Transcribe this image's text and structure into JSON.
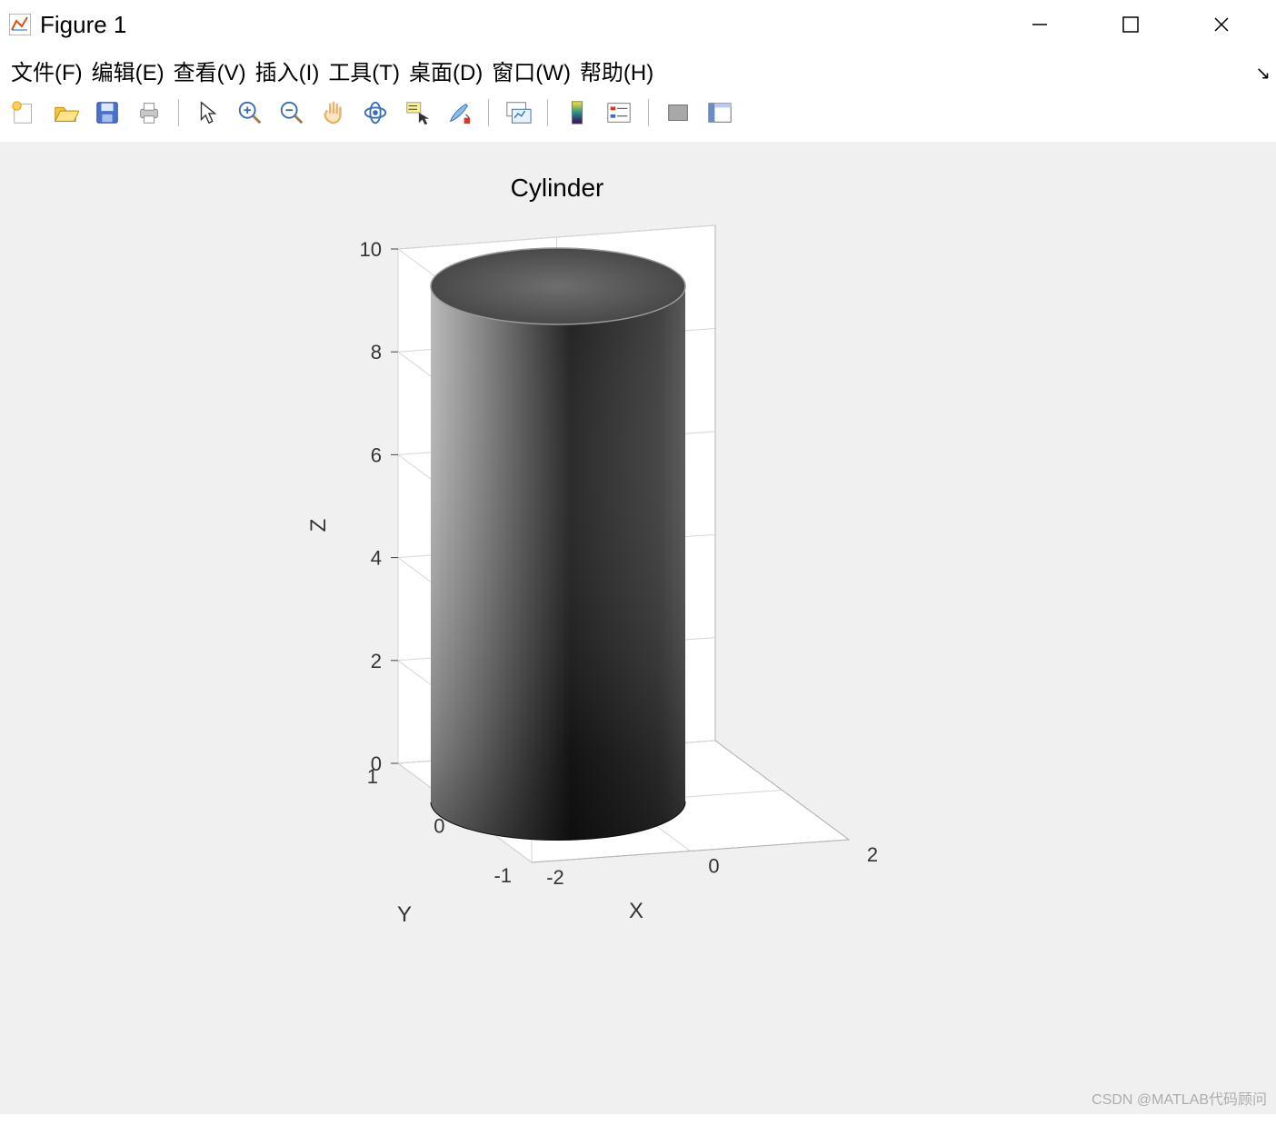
{
  "window": {
    "title": "Figure 1"
  },
  "menubar": {
    "file": "文件(F)",
    "edit": "编辑(E)",
    "view": "查看(V)",
    "insert": "插入(I)",
    "tools": "工具(T)",
    "desktop": "桌面(D)",
    "window": "窗口(W)",
    "help": "帮助(H)"
  },
  "watermark": "CSDN @MATLAB代码顾问",
  "chart_data": {
    "type": "surface-3d",
    "shape": "cylinder",
    "title": "Cylinder",
    "xlabel": "X",
    "ylabel": "Y",
    "zlabel": "Z",
    "x_ticks": [
      -2,
      0,
      2
    ],
    "y_ticks": [
      -1,
      0,
      1
    ],
    "z_ticks": [
      0,
      2,
      4,
      6,
      8,
      10
    ],
    "radius": 1.5,
    "height_range": [
      0,
      10
    ],
    "colormap": "gray"
  }
}
